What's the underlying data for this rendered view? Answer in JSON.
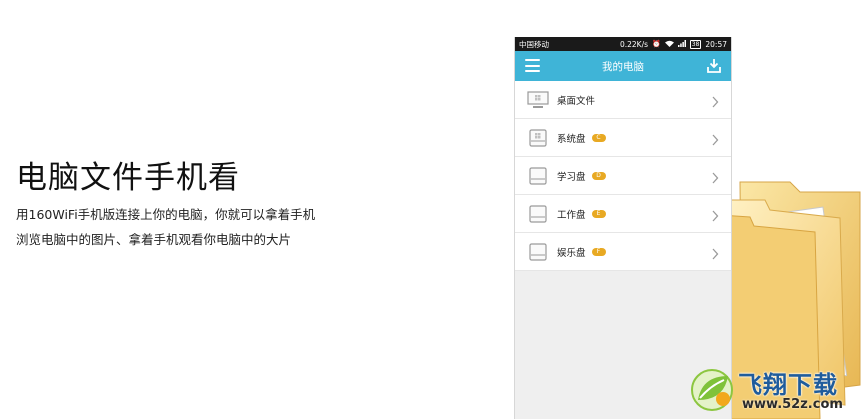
{
  "promo": {
    "title": "电脑文件手机看",
    "desc_line1": "用160WiFi手机版连接上你的电脑，你就可以拿着手机",
    "desc_line2": "浏览电脑中的图片、拿着手机观看你电脑中的大片"
  },
  "statusbar": {
    "carrier": "中国移动",
    "speed": "0.22K/s",
    "battery": "38",
    "time": "20:57"
  },
  "appbar": {
    "title": "我的电脑",
    "menu_icon": "hamburger-menu-icon",
    "download_icon": "download-icon"
  },
  "drives": [
    {
      "label": "桌面文件",
      "badge": "",
      "icon": "windows-monitor-icon"
    },
    {
      "label": "系统盘",
      "badge": "C",
      "icon": "windows-drive-icon"
    },
    {
      "label": "学习盘",
      "badge": "D",
      "icon": "hard-drive-icon"
    },
    {
      "label": "工作盘",
      "badge": "E",
      "icon": "hard-drive-icon"
    },
    {
      "label": "娱乐盘",
      "badge": "F",
      "icon": "hard-drive-icon"
    }
  ],
  "colors": {
    "appbar": "#3fb4d7",
    "badge": "#e8a923",
    "watermark_brand": "#1f5c9c"
  },
  "watermark": {
    "brand": "飞翔下载",
    "url": "www.52z.com"
  }
}
